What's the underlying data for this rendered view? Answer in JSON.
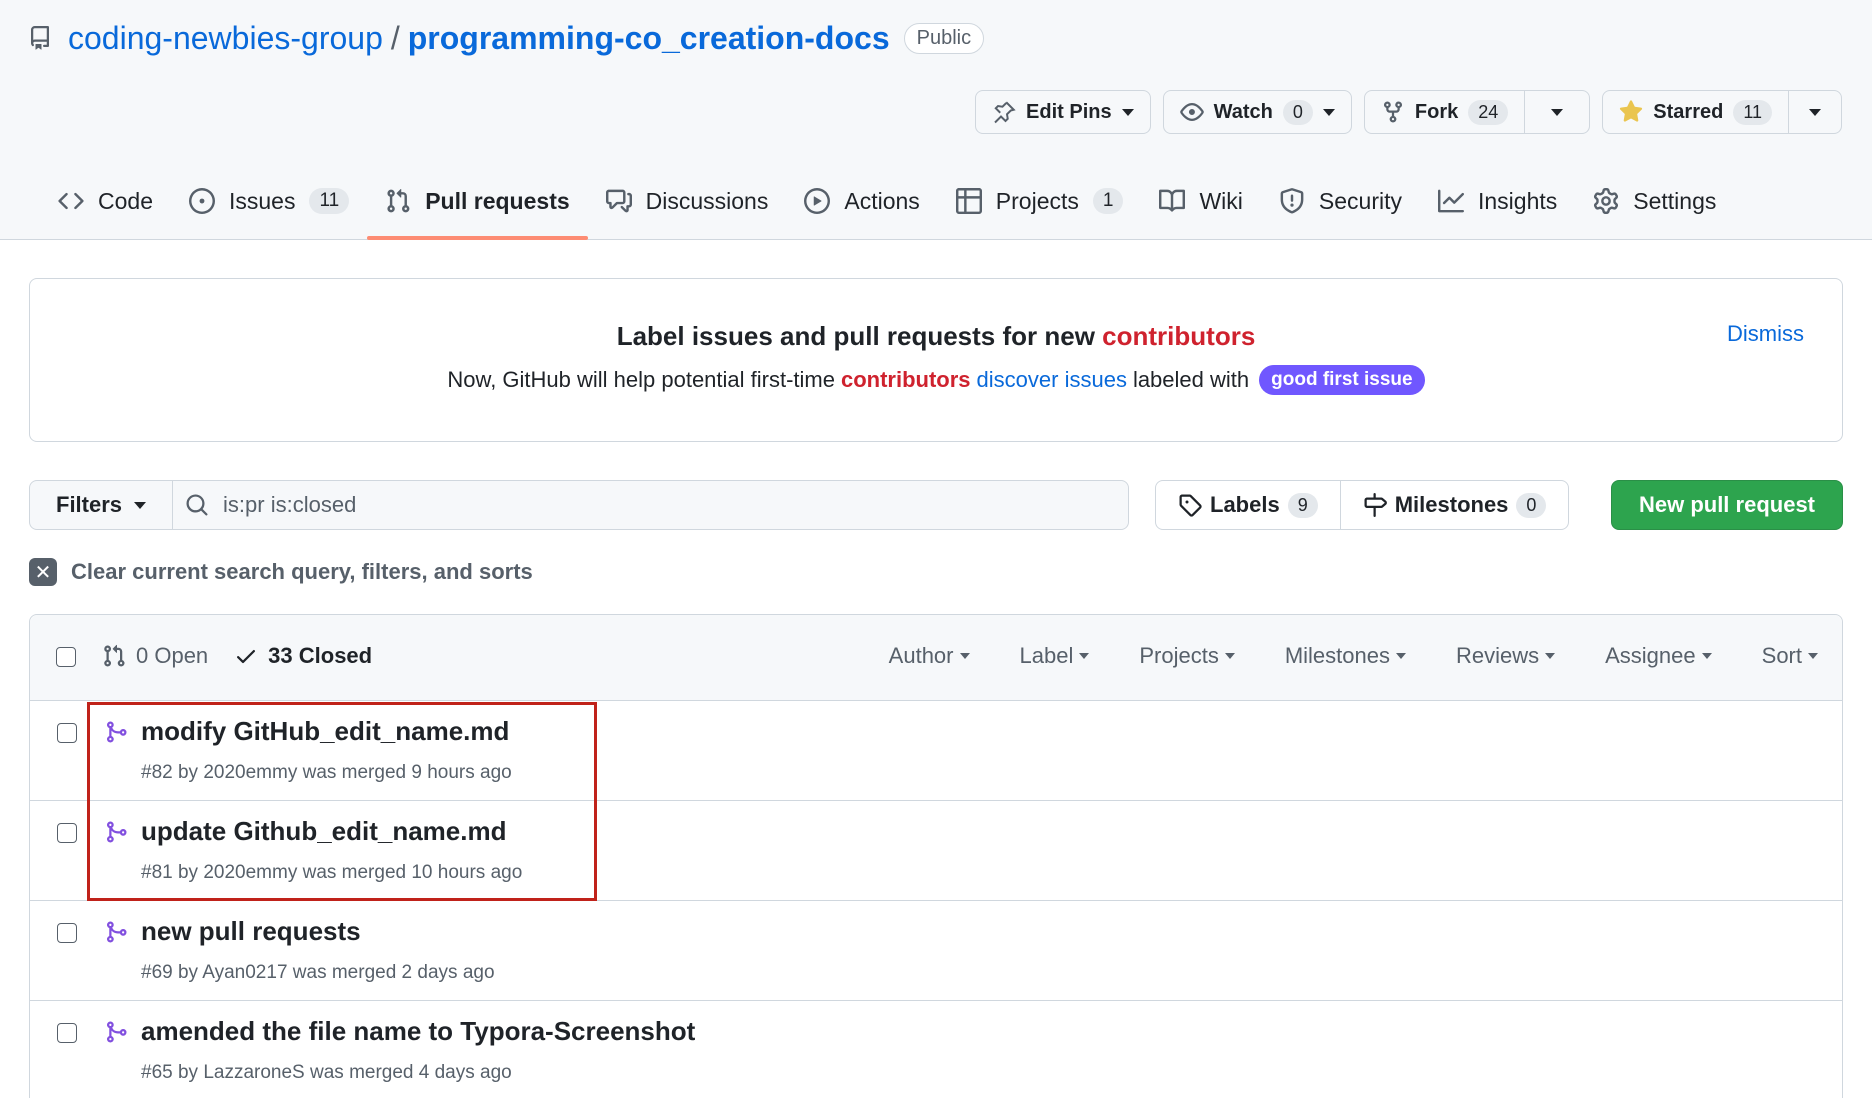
{
  "repo": {
    "owner": "coding-newbies-group",
    "separator": "/",
    "name": "programming-co_creation-docs",
    "visibility": "Public"
  },
  "repo_actions": {
    "edit_pins": "Edit Pins",
    "watch": "Watch",
    "watch_count": "0",
    "fork": "Fork",
    "fork_count": "24",
    "starred": "Starred",
    "star_count": "11"
  },
  "tabs": [
    {
      "label": "Code",
      "icon": "code-icon"
    },
    {
      "label": "Issues",
      "count": "11",
      "icon": "issue-icon"
    },
    {
      "label": "Pull requests",
      "icon": "pull-request-icon",
      "selected": true
    },
    {
      "label": "Discussions",
      "icon": "discussions-icon"
    },
    {
      "label": "Actions",
      "icon": "play-icon"
    },
    {
      "label": "Projects",
      "count": "1",
      "icon": "table-icon"
    },
    {
      "label": "Wiki",
      "icon": "book-icon"
    },
    {
      "label": "Security",
      "icon": "shield-icon"
    },
    {
      "label": "Insights",
      "icon": "graph-icon"
    },
    {
      "label": "Settings",
      "icon": "gear-icon"
    }
  ],
  "banner": {
    "title_prefix": "Label issues and pull requests for new ",
    "title_highlight": "contributors",
    "text_1": "Now, GitHub will help potential first-time",
    "text_contributors": "contributors",
    "text_link": "discover issues",
    "text_2": "labeled with",
    "label": "good first issue",
    "dismiss": "Dismiss"
  },
  "filter_bar": {
    "filters_label": "Filters",
    "search_value": "is:pr is:closed",
    "labels_label": "Labels",
    "labels_count": "9",
    "milestones_label": "Milestones",
    "milestones_count": "0",
    "new_pr_label": "New pull request"
  },
  "clear_filters": "Clear current search query, filters, and sorts",
  "list_header": {
    "open": "0 Open",
    "closed": "33 Closed",
    "sorts": [
      "Author",
      "Label",
      "Projects",
      "Milestones",
      "Reviews",
      "Assignee",
      "Sort"
    ]
  },
  "pull_requests": [
    {
      "title": "modify GitHub_edit_name.md",
      "meta": "#82 by 2020emmy was merged 9 hours ago"
    },
    {
      "title": "update Github_edit_name.md",
      "meta": "#81 by 2020emmy was merged 10 hours ago"
    },
    {
      "title": "new pull requests",
      "meta": "#69 by Ayan0217 was merged 2 days ago"
    },
    {
      "title": "amended the file name to Typora-Screenshot",
      "meta": "#65 by LazzaroneS was merged 4 days ago"
    }
  ],
  "colors": {
    "accent": "#0969da",
    "merged": "#8250df",
    "primary_button": "#2da44e",
    "tab_underline": "#fd8c73",
    "highlight_box": "#c0221a",
    "good_first_issue": "#7057ff"
  }
}
